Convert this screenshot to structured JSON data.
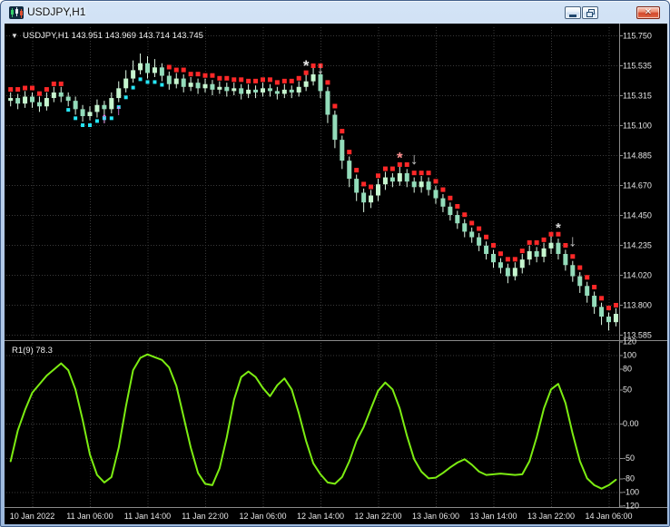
{
  "window": {
    "title": "USDJPY,H1",
    "close_glyph": "✕"
  },
  "main_chart": {
    "legend": "USDJPY,H1 143.951 143.969 143.714 143.745",
    "collapse_marker": "▼"
  },
  "colors": {
    "chart_bg": "#000000",
    "grid": "#3a3a3a",
    "axis_text": "#e6e6e6",
    "bull_candle": "#c6f6cf",
    "bear_candle": "#93dcba",
    "candle_stroke": "#def7e4",
    "dot_down": "#ff2828",
    "dot_up": "#27e7f7",
    "oscillator_line": "#7cec12",
    "divider": "#8a8a8a",
    "legend_text": "#f0f0f0"
  },
  "chart_data": {
    "type": "candlestick",
    "symbol": "USDJPY",
    "timeframe": "H1",
    "price_axis_labels": [
      "115.750",
      "115.535",
      "115.315",
      "115.100",
      "114.885",
      "114.670",
      "114.450",
      "114.235",
      "114.020",
      "113.800",
      "113.585"
    ],
    "time_axis_labels": [
      "10 Jan 2022",
      "11 Jan 06:00",
      "11 Jan 14:00",
      "11 Jan 22:00",
      "12 Jan 06:00",
      "12 Jan 14:00",
      "12 Jan 22:00",
      "13 Jan 06:00",
      "13 Jan 14:00",
      "13 Jan 22:00",
      "14 Jan 06:00"
    ],
    "candles_ohlc": [
      [
        115.28,
        115.34,
        115.24,
        115.3
      ],
      [
        115.3,
        115.33,
        115.22,
        115.26
      ],
      [
        115.26,
        115.35,
        115.23,
        115.31
      ],
      [
        115.31,
        115.34,
        115.23,
        115.27
      ],
      [
        115.27,
        115.31,
        115.2,
        115.24
      ],
      [
        115.24,
        115.34,
        115.21,
        115.3
      ],
      [
        115.3,
        115.38,
        115.27,
        115.34
      ],
      [
        115.34,
        115.38,
        115.27,
        115.31
      ],
      [
        115.31,
        115.34,
        115.24,
        115.28
      ],
      [
        115.28,
        115.31,
        115.18,
        115.22
      ],
      [
        115.22,
        115.25,
        115.13,
        115.17
      ],
      [
        115.17,
        115.24,
        115.14,
        115.2
      ],
      [
        115.2,
        115.29,
        115.16,
        115.25
      ],
      [
        115.25,
        115.28,
        115.12,
        115.22
      ],
      [
        115.22,
        115.34,
        115.19,
        115.3
      ],
      [
        115.3,
        115.42,
        115.27,
        115.37
      ],
      [
        115.37,
        115.5,
        115.34,
        115.44
      ],
      [
        115.44,
        115.57,
        115.41,
        115.5
      ],
      [
        115.5,
        115.62,
        115.47,
        115.55
      ],
      [
        115.55,
        115.6,
        115.44,
        115.48
      ],
      [
        115.48,
        115.58,
        115.45,
        115.52
      ],
      [
        115.52,
        115.55,
        115.42,
        115.46
      ],
      [
        115.46,
        115.49,
        115.36,
        115.4
      ],
      [
        115.4,
        115.48,
        115.37,
        115.44
      ],
      [
        115.44,
        115.47,
        115.34,
        115.38
      ],
      [
        115.38,
        115.45,
        115.35,
        115.41
      ],
      [
        115.41,
        115.44,
        115.33,
        115.37
      ],
      [
        115.37,
        115.44,
        115.34,
        115.4
      ],
      [
        115.4,
        115.43,
        115.32,
        115.36
      ],
      [
        115.36,
        115.42,
        115.33,
        115.38
      ],
      [
        115.38,
        115.41,
        115.31,
        115.35
      ],
      [
        115.35,
        115.41,
        115.32,
        115.37
      ],
      [
        115.37,
        115.4,
        115.29,
        115.33
      ],
      [
        115.33,
        115.4,
        115.3,
        115.36
      ],
      [
        115.36,
        115.39,
        115.3,
        115.34
      ],
      [
        115.34,
        115.41,
        115.31,
        115.37
      ],
      [
        115.37,
        115.4,
        115.31,
        115.35
      ],
      [
        115.35,
        115.38,
        115.29,
        115.33
      ],
      [
        115.33,
        115.4,
        115.3,
        115.36
      ],
      [
        115.36,
        115.39,
        115.3,
        115.34
      ],
      [
        115.34,
        115.42,
        115.31,
        115.38
      ],
      [
        115.38,
        115.48,
        115.35,
        115.42
      ],
      [
        115.42,
        115.53,
        115.39,
        115.47
      ],
      [
        115.47,
        115.5,
        115.3,
        115.35
      ],
      [
        115.35,
        115.38,
        115.12,
        115.18
      ],
      [
        115.18,
        115.21,
        114.94,
        115.0
      ],
      [
        115.0,
        115.03,
        114.79,
        114.85
      ],
      [
        114.85,
        114.88,
        114.66,
        114.72
      ],
      [
        114.72,
        114.75,
        114.56,
        114.62
      ],
      [
        114.62,
        114.65,
        114.48,
        114.55
      ],
      [
        114.55,
        114.64,
        114.51,
        114.6
      ],
      [
        114.6,
        114.72,
        114.56,
        114.68
      ],
      [
        114.68,
        114.77,
        114.64,
        114.73
      ],
      [
        114.73,
        114.76,
        114.66,
        114.7
      ],
      [
        114.7,
        114.81,
        114.67,
        114.76
      ],
      [
        114.76,
        114.79,
        114.66,
        114.7
      ],
      [
        114.7,
        114.73,
        114.62,
        114.66
      ],
      [
        114.66,
        114.74,
        114.62,
        114.7
      ],
      [
        114.7,
        114.73,
        114.6,
        114.64
      ],
      [
        114.64,
        114.67,
        114.54,
        114.58
      ],
      [
        114.58,
        114.61,
        114.48,
        114.52
      ],
      [
        114.52,
        114.55,
        114.42,
        114.46
      ],
      [
        114.46,
        114.49,
        114.36,
        114.4
      ],
      [
        114.4,
        114.43,
        114.3,
        114.34
      ],
      [
        114.34,
        114.37,
        114.26,
        114.3
      ],
      [
        114.3,
        114.33,
        114.2,
        114.24
      ],
      [
        114.24,
        114.27,
        114.14,
        114.18
      ],
      [
        114.18,
        114.21,
        114.08,
        114.12
      ],
      [
        114.12,
        114.15,
        114.04,
        114.08
      ],
      [
        114.08,
        114.11,
        113.97,
        114.02
      ],
      [
        114.02,
        114.12,
        113.99,
        114.08
      ],
      [
        114.08,
        114.18,
        114.04,
        114.14
      ],
      [
        114.14,
        114.24,
        114.1,
        114.2
      ],
      [
        114.2,
        114.23,
        114.12,
        114.16
      ],
      [
        114.16,
        114.26,
        114.12,
        114.22
      ],
      [
        114.22,
        114.31,
        114.18,
        114.26
      ],
      [
        114.26,
        114.29,
        114.14,
        114.18
      ],
      [
        114.18,
        114.21,
        114.06,
        114.1
      ],
      [
        114.1,
        114.13,
        113.98,
        114.02
      ],
      [
        114.02,
        114.05,
        113.9,
        113.95
      ],
      [
        113.95,
        113.98,
        113.83,
        113.88
      ],
      [
        113.88,
        113.91,
        113.75,
        113.8
      ],
      [
        113.8,
        113.83,
        113.67,
        113.73
      ],
      [
        113.73,
        113.76,
        113.63,
        113.69
      ],
      [
        113.69,
        113.79,
        113.66,
        113.75
      ]
    ],
    "trend_up_bars": [
      8,
      21
    ],
    "markers": [
      {
        "bar": 13,
        "price": 115.12,
        "glyph": "↑",
        "color": "#f080f0",
        "size": 17
      },
      {
        "bar": 15,
        "price": 115.18,
        "glyph": "↑",
        "color": "#f080f0",
        "size": 17
      },
      {
        "bar": 41,
        "price": 115.56,
        "glyph": "*",
        "color": "#e8e8e8",
        "size": 17
      },
      {
        "bar": 43,
        "price": 115.58,
        "glyph": "↓",
        "color": "#c4c4c4",
        "size": 18
      },
      {
        "bar": 54,
        "price": 114.9,
        "glyph": "*",
        "color": "#ff9090",
        "size": 17
      },
      {
        "bar": 56,
        "price": 114.93,
        "glyph": "↓",
        "color": "#c4c4c4",
        "size": 18
      },
      {
        "bar": 76,
        "price": 114.4,
        "glyph": "*",
        "color": "#d8d8d8",
        "size": 15
      },
      {
        "bar": 78,
        "price": 114.34,
        "glyph": "↓",
        "color": "#c4c4c4",
        "size": 18
      }
    ],
    "oscillator": {
      "label": "R1(9) 78.3",
      "ylim": [
        -120,
        120
      ],
      "axis_labels": [
        "120",
        "100",
        "80",
        "50",
        "0.00",
        "-50",
        "-80",
        "-100",
        "-120"
      ],
      "gridline_values": [
        100,
        50,
        0,
        -50,
        -100
      ],
      "points": [
        [
          0,
          -55
        ],
        [
          1,
          -10
        ],
        [
          2,
          20
        ],
        [
          3,
          45
        ],
        [
          5,
          70
        ],
        [
          7,
          88
        ],
        [
          8,
          78
        ],
        [
          9,
          50
        ],
        [
          10,
          5
        ],
        [
          11,
          -45
        ],
        [
          12,
          -75
        ],
        [
          13,
          -86
        ],
        [
          14,
          -78
        ],
        [
          15,
          -35
        ],
        [
          16,
          25
        ],
        [
          17,
          78
        ],
        [
          18,
          96
        ],
        [
          19,
          101
        ],
        [
          20,
          97
        ],
        [
          21,
          93
        ],
        [
          22,
          82
        ],
        [
          23,
          55
        ],
        [
          24,
          10
        ],
        [
          25,
          -35
        ],
        [
          26,
          -72
        ],
        [
          27,
          -88
        ],
        [
          28,
          -90
        ],
        [
          29,
          -65
        ],
        [
          30,
          -20
        ],
        [
          31,
          35
        ],
        [
          32,
          68
        ],
        [
          33,
          76
        ],
        [
          34,
          68
        ],
        [
          35,
          52
        ],
        [
          36,
          40
        ],
        [
          37,
          56
        ],
        [
          38,
          66
        ],
        [
          39,
          50
        ],
        [
          40,
          15
        ],
        [
          41,
          -25
        ],
        [
          42,
          -58
        ],
        [
          43,
          -74
        ],
        [
          44,
          -86
        ],
        [
          45,
          -88
        ],
        [
          46,
          -78
        ],
        [
          47,
          -55
        ],
        [
          48,
          -25
        ],
        [
          49,
          -5
        ],
        [
          50,
          22
        ],
        [
          51,
          48
        ],
        [
          52,
          60
        ],
        [
          53,
          50
        ],
        [
          54,
          22
        ],
        [
          55,
          -18
        ],
        [
          56,
          -52
        ],
        [
          57,
          -70
        ],
        [
          58,
          -80
        ],
        [
          59,
          -79
        ],
        [
          60,
          -72
        ],
        [
          61,
          -64
        ],
        [
          62,
          -57
        ],
        [
          63,
          -52
        ],
        [
          64,
          -60
        ],
        [
          65,
          -70
        ],
        [
          66,
          -75
        ],
        [
          67,
          -74
        ],
        [
          68,
          -73
        ],
        [
          69,
          -74
        ],
        [
          70,
          -75
        ],
        [
          71,
          -74
        ],
        [
          72,
          -55
        ],
        [
          73,
          -20
        ],
        [
          74,
          22
        ],
        [
          75,
          50
        ],
        [
          76,
          58
        ],
        [
          77,
          30
        ],
        [
          78,
          -15
        ],
        [
          79,
          -55
        ],
        [
          80,
          -80
        ],
        [
          81,
          -90
        ],
        [
          82,
          -95
        ],
        [
          83,
          -90
        ],
        [
          84,
          -82
        ]
      ]
    }
  }
}
